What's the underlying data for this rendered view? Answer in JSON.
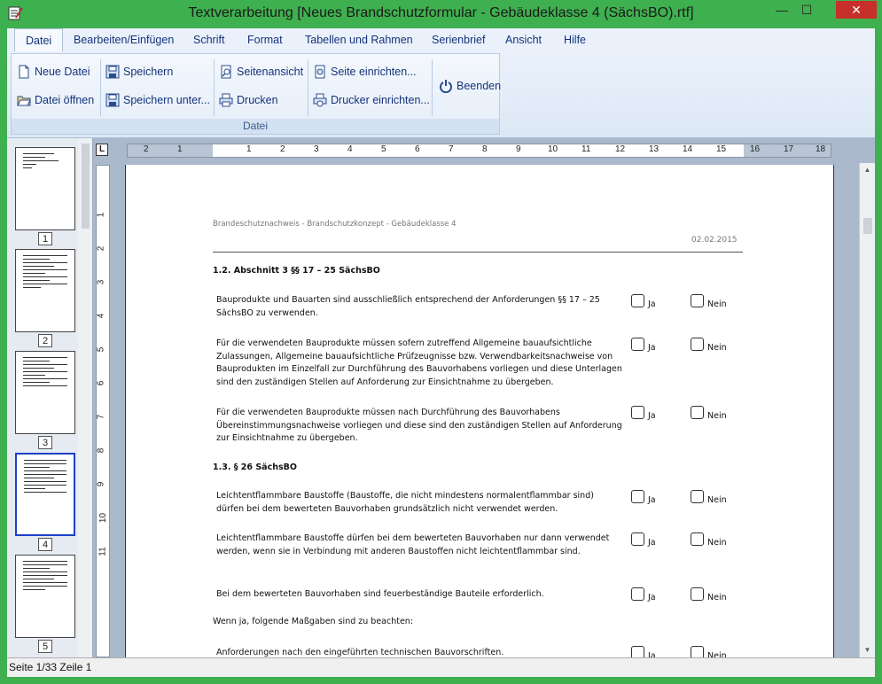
{
  "window": {
    "title": "Textverarbeitung [Neues Brandschutzformular - Gebäudeklasse 4 (SächsBO).rtf]",
    "close_glyph": "✕",
    "min_glyph": "—",
    "max_glyph": "☐"
  },
  "menu": {
    "tabs": [
      "Datei",
      "Bearbeiten/Einfügen",
      "Schrift",
      "Format",
      "Tabellen und Rahmen",
      "Serienbrief",
      "Ansicht",
      "Hilfe"
    ],
    "active": "Datei"
  },
  "ribbon": {
    "group_label": "Datei",
    "buttons": {
      "new_file": "Neue Datei",
      "open_file": "Datei öffnen",
      "save": "Speichern",
      "save_as": "Speichern unter...",
      "page_view": "Seitenansicht",
      "print": "Drucken",
      "page_setup": "Seite einrichten...",
      "printer_setup": "Drucker einrichten...",
      "exit": "Beenden"
    },
    "icons": {
      "new_file": "new-file-icon",
      "open_file": "open-folder-icon",
      "save": "save-icon",
      "save_as": "save-as-icon",
      "page_view": "page-preview-icon",
      "print": "printer-icon",
      "page_setup": "page-setup-icon",
      "printer_setup": "printer-setup-icon",
      "exit": "power-icon"
    }
  },
  "thumbnails": {
    "pages": [
      "1",
      "2",
      "3",
      "4",
      "5"
    ],
    "active_page": "4"
  },
  "ruler": {
    "corner": "L",
    "h_numbers": [
      "2",
      "1",
      "1",
      "2",
      "3",
      "4",
      "5",
      "6",
      "7",
      "8",
      "9",
      "10",
      "11",
      "12",
      "13",
      "14",
      "15",
      "16",
      "17",
      "18"
    ],
    "v_numbers": [
      "1",
      "2",
      "3",
      "4",
      "5",
      "6",
      "7",
      "8",
      "9",
      "10",
      "11"
    ]
  },
  "document": {
    "header": "Brandeschutznachweis - Brandschutzkonzept - Gebäudeklasse 4",
    "date": "02.02.2015",
    "section1_heading": "1.2. Abschnitt 3 §§ 17 – 25 SächsBO",
    "section2_heading": "1.3. § 26 SächsBO",
    "checkbox_yes": "Ja",
    "checkbox_no": "Nein",
    "paragraphs": [
      "Bauprodukte und Bauarten sind ausschließlich entsprechend der Anforderungen §§ 17 – 25 SächsBO zu verwenden.",
      "Für die verwendeten Bauprodukte müssen sofern zutreffend Allgemeine bauaufsichtliche Zulassungen, Allgemeine bauaufsichtliche Prüfzeugnisse bzw. Verwendbarkeitsnachweise von Bauprodukten im Einzelfall zur Durchführung des Bauvorhabens vorliegen und diese Unterlagen sind den zuständigen Stellen auf Anforderung zur Einsichtnahme zu übergeben.",
      "Für die verwendeten Bauprodukte müssen nach Durchführung des Bauvorhabens Übereinstimmungsnachweise vorliegen und diese sind den zuständigen Stellen auf Anforderung zur Einsichtnahme zu übergeben.",
      "Leichtentflammbare Baustoffe (Baustoffe, die nicht mindestens normalentflammbar sind) dürfen bei dem bewerteten Bauvorhaben grundsätzlich nicht verwendet werden.",
      "Leichtentflammbare Baustoffe dürfen bei dem bewerteten Bauvorhaben nur dann verwendet werden, wenn sie in Verbindung mit anderen Baustoffen nicht leichtentflammbar sind.",
      "Bei dem bewerteten Bauvorhaben sind feuerbeständige Bauteile erforderlich.",
      "Anforderungen nach den eingeführten technischen Bauvorschriften."
    ],
    "note": "Wenn ja, folgende Maßgaben sind zu beachten:"
  },
  "status": {
    "text": "Seite 1/33 Zeile 1"
  },
  "colors": {
    "window_frame": "#3fb04f",
    "ribbon_text": "#15337a",
    "active_thumb_border": "#1e3fc9"
  }
}
